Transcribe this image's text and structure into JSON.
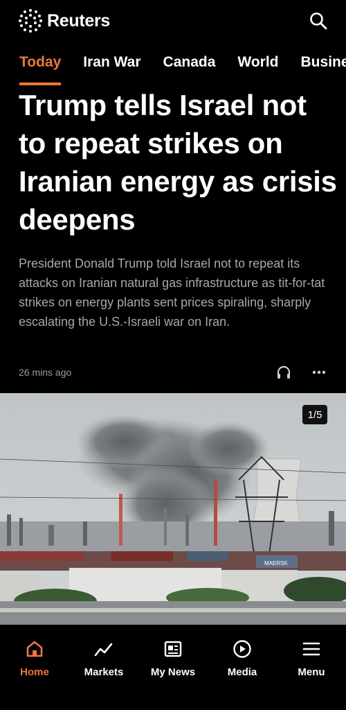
{
  "app": {
    "brand": "Reuters",
    "accent_color": "#f0763c"
  },
  "header": {
    "search_icon": "search-icon"
  },
  "nav": {
    "tabs": [
      {
        "label": "Today",
        "active": true
      },
      {
        "label": "Iran War"
      },
      {
        "label": "Canada"
      },
      {
        "label": "World"
      },
      {
        "label": "Busine"
      }
    ]
  },
  "article": {
    "headline": "Trump tells Israel not to repeat strikes on Iranian energy as crisis deepens",
    "summary": "President Donald Trump told Israel not to repeat its attacks on Iranian natural gas infrastructure as tit-for-tat strikes on energy plants sent prices spiraling, sharply escalating the U.S.-Israeli war on Iran.",
    "timestamp": "26 mins ago",
    "photo_counter": "1/5",
    "photo_sign": "MAERSK"
  },
  "tabbar": {
    "items": [
      {
        "label": "Home",
        "icon": "home-icon",
        "active": true
      },
      {
        "label": "Markets",
        "icon": "chart-trend-icon"
      },
      {
        "label": "My News",
        "icon": "news-icon"
      },
      {
        "label": "Media",
        "icon": "play-circle-icon"
      },
      {
        "label": "Menu",
        "icon": "hamburger-menu-icon"
      }
    ]
  }
}
